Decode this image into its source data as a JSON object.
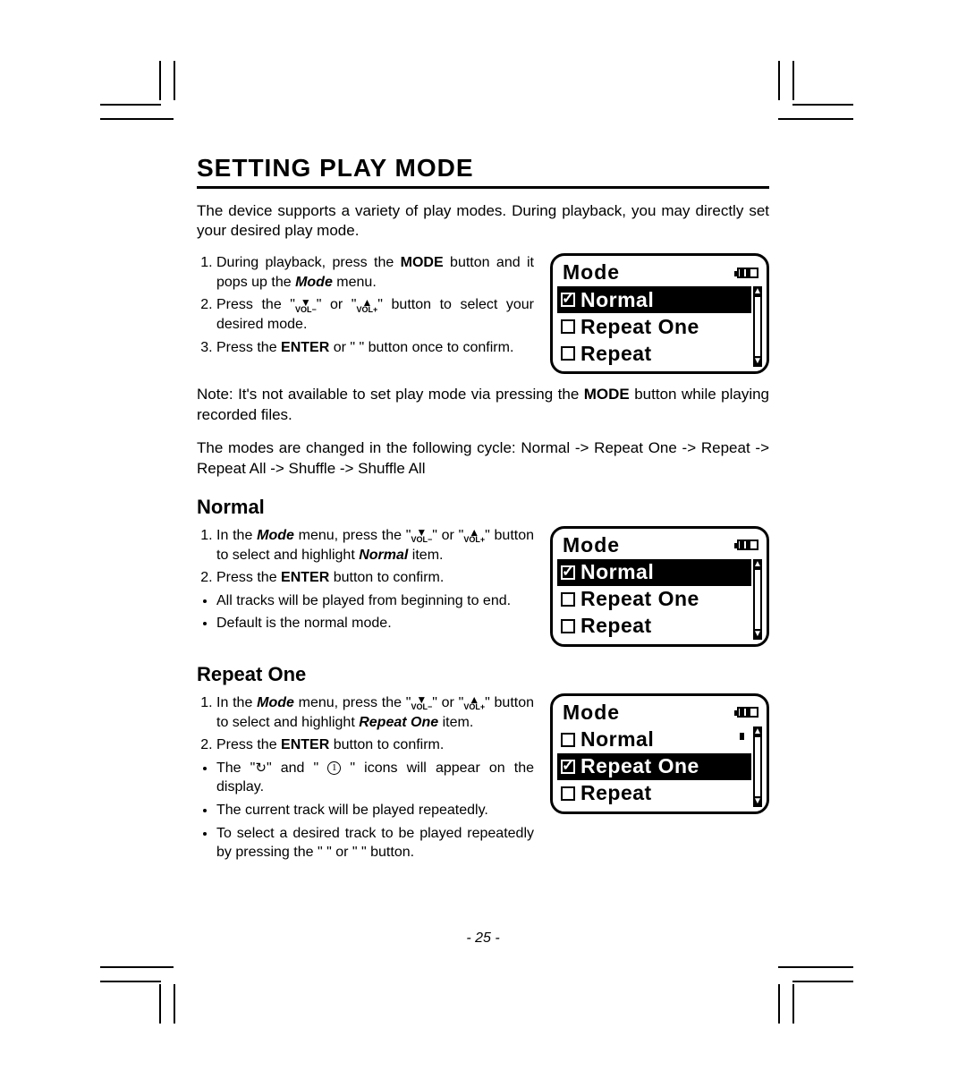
{
  "title": "SETTING PLAY MODE",
  "intro": "The device supports a variety of play modes. During playback, you may directly set your desired play mode.",
  "steps_main": {
    "s1a": "During playback, press the ",
    "s1b": "MODE",
    "s1c": " button and it pops up the ",
    "s1d": "Mode",
    "s1e": " menu.",
    "s2a": "Press the \"",
    "s2b": "\" or \"",
    "s2c": "\" button to select your desired mode.",
    "s3a": "Press the ",
    "s3b": "ENTER",
    "s3c": " or \"    \" button once to confirm."
  },
  "note_a": "Note: It's not available to set play mode via pressing the ",
  "note_b": "MODE",
  "note_c": " button while playing recorded files.",
  "cycle": "The modes are changed in the following cycle: Normal -> Repeat One -> Repeat -> Repeat All -> Shuffle -> Shuffle All",
  "vol_minus": "VOL−",
  "vol_plus": "VOL+",
  "section_normal": {
    "heading": "Normal",
    "s1a": "In the ",
    "s1b": "Mode",
    "s1c": " menu, press the \"",
    "s1d": "\" or \"",
    "s1e": "\" button to select and highlight ",
    "s1f": "Normal",
    "s1g": " item.",
    "s2a": "Press the ",
    "s2b": "ENTER",
    "s2c": " button to confirm.",
    "b1": "All tracks will be played from beginning to end.",
    "b2": "Default is the normal mode."
  },
  "section_repeat_one": {
    "heading": "Repeat One",
    "s1a": "In the ",
    "s1b": "Mode",
    "s1c": " menu, press the \"",
    "s1d": "\" or \"",
    "s1e": "\" button to select and highlight ",
    "s1f": "Repeat One",
    "s1g": " item.",
    "s2a": "Press the ",
    "s2b": "ENTER",
    "s2c": " button to confirm.",
    "b1a": "The \"",
    "b1b": "\" and \" ",
    "b1c": " \" icons will appear on the display.",
    "b2": "The current track will be played repeatedly.",
    "b3": "To select a desired track to be played repeatedly by pressing the \"    \" or \"    \" button."
  },
  "lcd": {
    "title": "Mode",
    "items": [
      "Normal",
      "Repeat One",
      "Repeat"
    ]
  },
  "page_number": "- 25 -"
}
